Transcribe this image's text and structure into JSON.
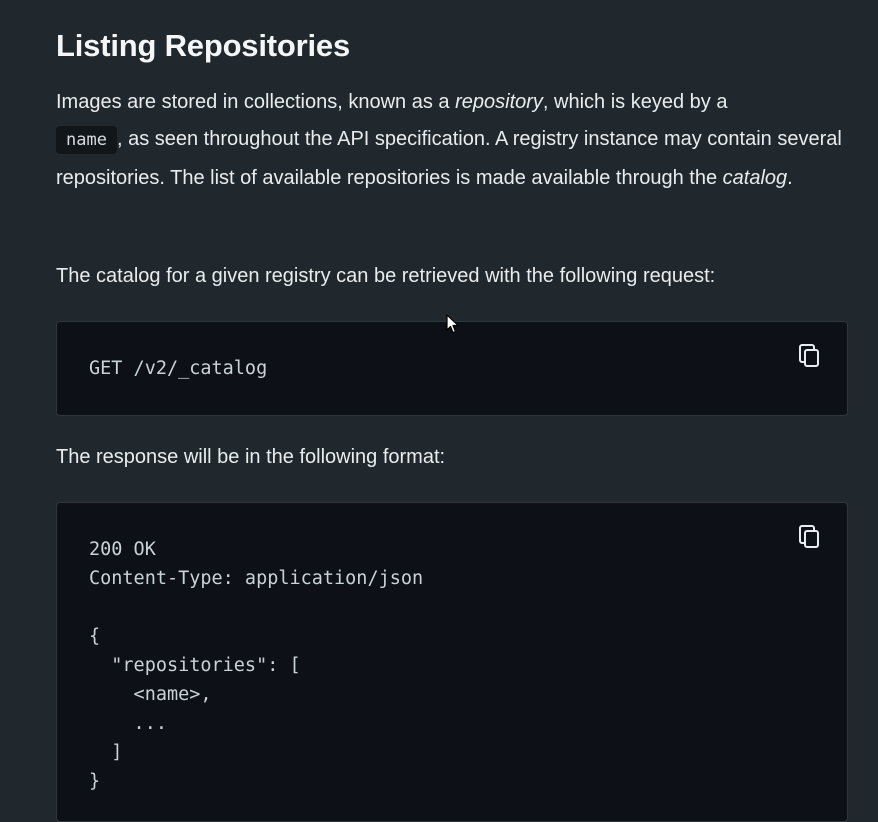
{
  "heading": "Listing Repositories",
  "intro": {
    "part1": "Images are stored in collections, known as a ",
    "em_repository": "repository",
    "part2": ", which is keyed by a ",
    "code_name": "name",
    "part3": ", as seen throughout the API specification. A registry instance may contain several repositories. The list of available repositories is made available through the ",
    "em_catalog": "catalog",
    "part4": "."
  },
  "catalog_request_text": "The catalog for a given registry can be retrieved with the following request:",
  "code_request": "GET /v2/_catalog",
  "response_text": "The response will be in the following format:",
  "code_response": "200 OK\nContent-Type: application/json\n\n{\n  \"repositories\": [\n    <name>,\n    ...\n  ]\n}",
  "icons": {
    "copy": "copy-icon",
    "cursor": "mouse-pointer-icon"
  },
  "colors": {
    "background": "#21282d",
    "code_background": "#0d1117",
    "text": "#e8ecee"
  }
}
